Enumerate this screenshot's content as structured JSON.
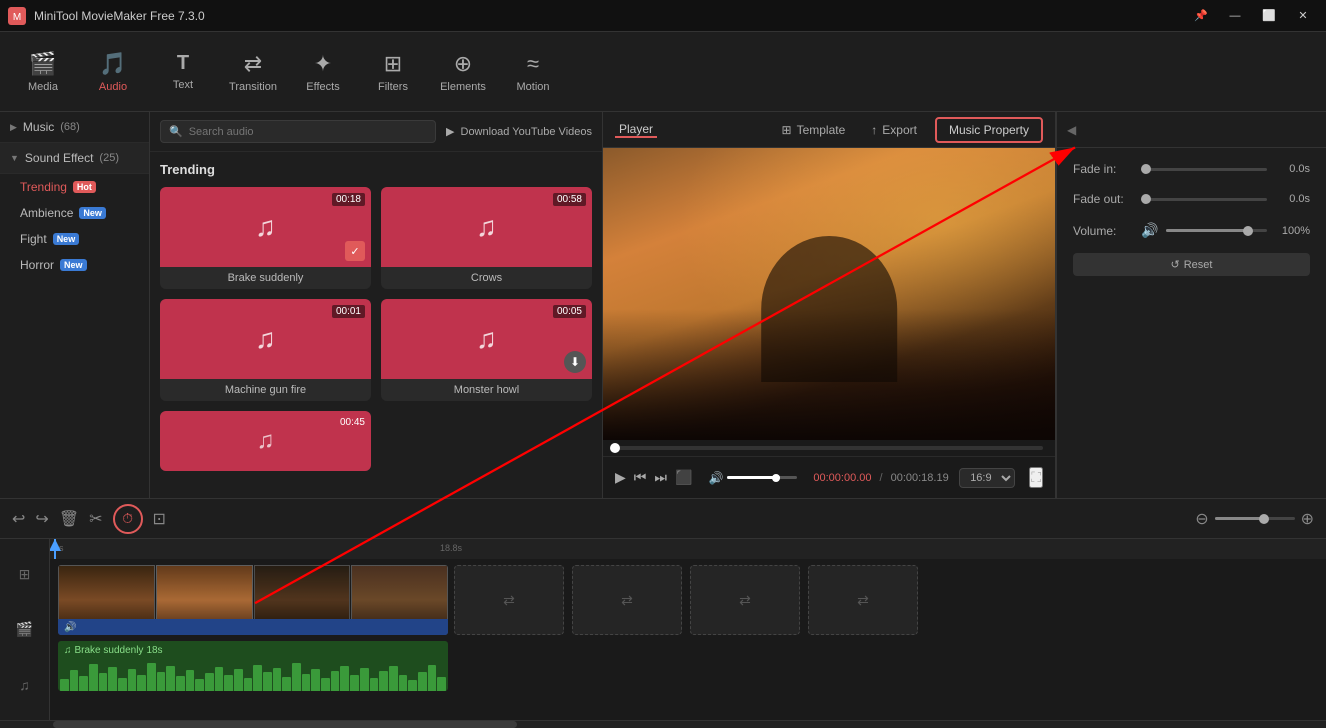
{
  "app": {
    "title": "MiniTool MovieMaker Free 7.3.0"
  },
  "toolbar": {
    "items": [
      {
        "id": "media",
        "label": "Media",
        "icon": "🎬",
        "active": false
      },
      {
        "id": "audio",
        "label": "Audio",
        "icon": "🎵",
        "active": true
      },
      {
        "id": "text",
        "label": "Text",
        "icon": "T",
        "active": false
      },
      {
        "id": "transition",
        "label": "Transition",
        "icon": "⇄",
        "active": false
      },
      {
        "id": "effects",
        "label": "Effects",
        "icon": "✦",
        "active": false
      },
      {
        "id": "filters",
        "label": "Filters",
        "icon": "⊞",
        "active": false
      },
      {
        "id": "elements",
        "label": "Elements",
        "icon": "⊕",
        "active": false
      },
      {
        "id": "motion",
        "label": "Motion",
        "icon": "≈",
        "active": false
      }
    ]
  },
  "sidebar": {
    "music_section": "Music",
    "music_count": "(68)",
    "sound_effect_section": "Sound Effect",
    "sound_effect_count": "(25)",
    "subsections": [
      {
        "label": "Trending",
        "badge": "Hot",
        "badge_type": "hot",
        "active": true
      },
      {
        "label": "Ambience",
        "badge": "New",
        "badge_type": "new",
        "active": false
      },
      {
        "label": "Fight",
        "badge": "New",
        "badge_type": "new",
        "active": false
      },
      {
        "label": "Horror",
        "badge": "New",
        "badge_type": "new",
        "active": false
      }
    ]
  },
  "content": {
    "search_placeholder": "Search audio",
    "yt_download": "Download YouTube Videos",
    "section_label": "Trending",
    "audio_cards": [
      {
        "name": "Brake suddenly",
        "duration": "00:18",
        "has_check": true,
        "has_dl": false
      },
      {
        "name": "Crows",
        "duration": "00:58",
        "has_check": false,
        "has_dl": false
      },
      {
        "name": "Machine gun fire",
        "duration": "00:01",
        "has_check": false,
        "has_dl": false
      },
      {
        "name": "Monster howl",
        "duration": "00:05",
        "has_check": false,
        "has_dl": true
      }
    ],
    "partial_card_duration": "00:45"
  },
  "player": {
    "tab": "Player",
    "template_label": "Template",
    "export_label": "Export",
    "music_property_label": "Music Property",
    "time_current": "00:00:00.00",
    "time_total": "00:00:18.19",
    "volume_pct": 75,
    "aspect_ratio": "16:9",
    "progress_pct": 0
  },
  "music_property": {
    "title": "Music Property",
    "fade_in_label": "Fade in:",
    "fade_in_value": "0.0s",
    "fade_in_pct": 0,
    "fade_out_label": "Fade out:",
    "fade_out_value": "0.0s",
    "fade_out_pct": 0,
    "volume_label": "Volume:",
    "volume_value": "100%",
    "volume_pct": 80,
    "reset_label": "Reset"
  },
  "timeline": {
    "marks": [
      "0s",
      "18.8s"
    ],
    "playhead_pct": 1,
    "audio_track_label": "Brake suddenly",
    "audio_track_duration": "18s"
  },
  "wincontrols": {
    "minimize": "—",
    "maximize": "⬜",
    "close": "✕",
    "pin": "📌"
  }
}
